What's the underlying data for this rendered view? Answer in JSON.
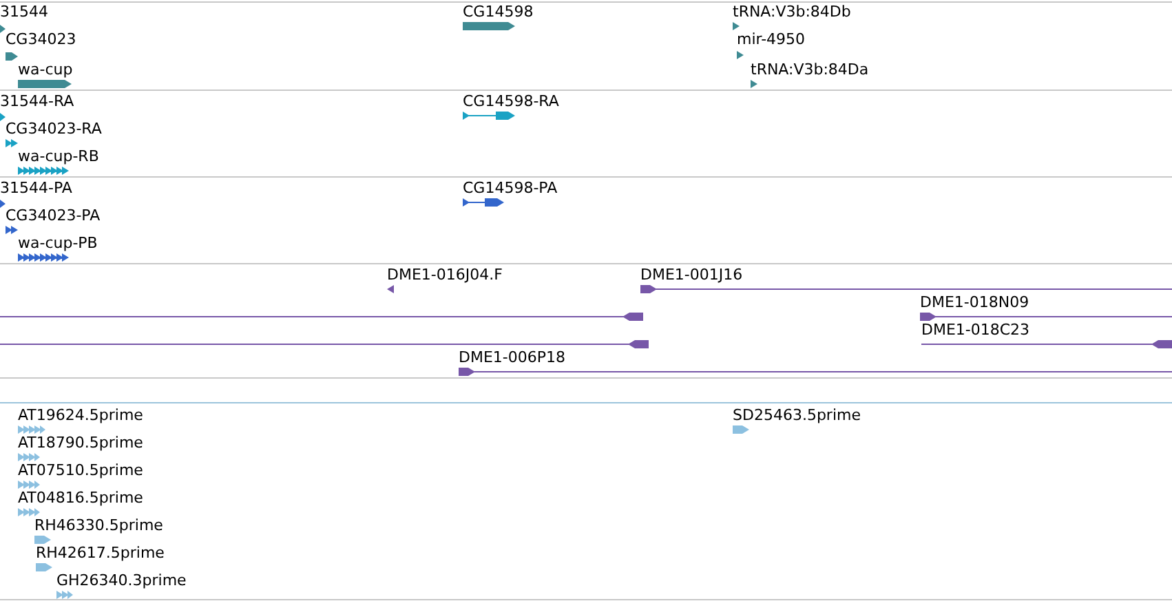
{
  "tracks": [
    {
      "kind": "gene",
      "features": [
        {
          "label": "31544",
          "forward": true
        },
        {
          "label": "CG34023",
          "forward": true
        },
        {
          "label": "wa-cup",
          "forward": true
        },
        {
          "label": "CG14598",
          "forward": true
        },
        {
          "label": "tRNA:V3b:84Db",
          "forward": true
        },
        {
          "label": "mir-4950",
          "forward": true
        },
        {
          "label": "tRNA:V3b:84Da",
          "forward": true
        }
      ]
    },
    {
      "kind": "transcript",
      "features": [
        {
          "label": "31544-RA",
          "forward": true
        },
        {
          "label": "CG34023-RA",
          "forward": true
        },
        {
          "label": "wa-cup-RB",
          "forward": true
        },
        {
          "label": "CG14598-RA",
          "forward": true
        }
      ]
    },
    {
      "kind": "protein",
      "features": [
        {
          "label": "31544-PA",
          "forward": true
        },
        {
          "label": "CG34023-PA",
          "forward": true
        },
        {
          "label": "wa-cup-PB",
          "forward": true
        },
        {
          "label": "CG14598-PA",
          "forward": true
        }
      ]
    },
    {
      "kind": "clone",
      "features": [
        {
          "label": "DME1-016J04.F",
          "forward": false
        },
        {
          "label": "DME1-001J16",
          "forward": true
        },
        {
          "forward": false
        },
        {
          "label": "DME1-018N09",
          "forward": true
        },
        {
          "forward": false
        },
        {
          "label": "DME1-018C23",
          "forward": false
        },
        {
          "label": "DME1-006P18",
          "forward": true
        }
      ]
    },
    {
      "kind": "empty"
    },
    {
      "kind": "est",
      "features": [
        {
          "label": "AT19624.5prime",
          "forward": true
        },
        {
          "label": "AT18790.5prime",
          "forward": true
        },
        {
          "label": "AT07510.5prime",
          "forward": true
        },
        {
          "label": "AT04816.5prime",
          "forward": true
        },
        {
          "label": "RH46330.5prime",
          "forward": true
        },
        {
          "label": "RH42617.5prime",
          "forward": true
        },
        {
          "label": "GH26340.3prime",
          "forward": true
        },
        {
          "label": "SD25463.5prime",
          "forward": true
        }
      ]
    }
  ]
}
